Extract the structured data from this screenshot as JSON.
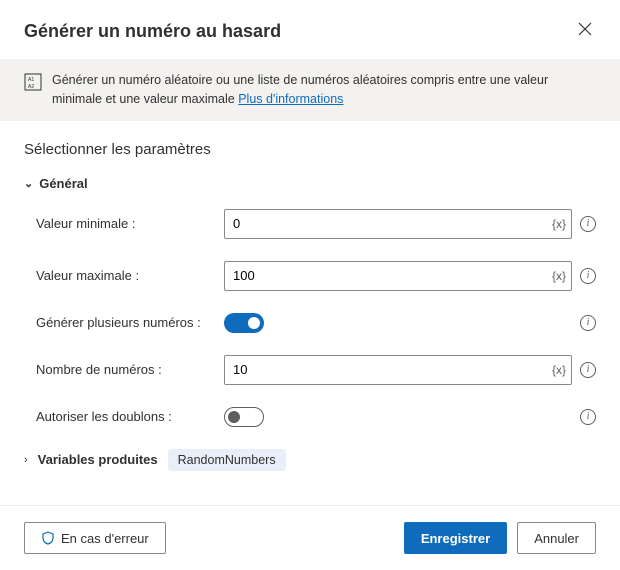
{
  "header": {
    "title": "Générer un numéro au hasard"
  },
  "banner": {
    "text_before": "Générer un numéro aléatoire ou une liste de numéros aléatoires compris entre une valeur minimale et une valeur maximale ",
    "link": "Plus d'informations"
  },
  "body": {
    "section_title": "Sélectionner les paramètres",
    "general_label": "Général",
    "fields": {
      "min": {
        "label": "Valeur minimale :",
        "value": "0"
      },
      "max": {
        "label": "Valeur maximale :",
        "value": "100"
      },
      "multi": {
        "label": "Générer plusieurs numéros :",
        "on": true
      },
      "count": {
        "label": "Nombre de numéros :",
        "value": "10"
      },
      "dupes": {
        "label": "Autoriser les doublons :",
        "on": false
      }
    },
    "variables": {
      "label": "Variables produites",
      "badge": "RandomNumbers"
    }
  },
  "footer": {
    "on_error": "En cas d'erreur",
    "save": "Enregistrer",
    "cancel": "Annuler"
  }
}
